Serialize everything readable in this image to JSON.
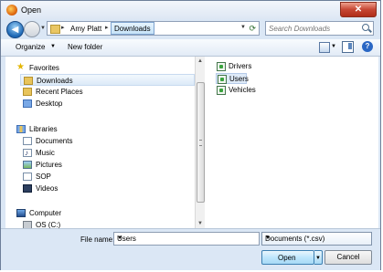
{
  "window": {
    "title": "Open",
    "close_glyph": "✕"
  },
  "address_bar": {
    "crumbs": [
      "Amy Platt",
      "Downloads"
    ],
    "separator": "▸",
    "refresh_glyph": "⟳"
  },
  "search": {
    "placeholder": "Search Downloads"
  },
  "toolbar": {
    "organize_label": "Organize",
    "new_folder_label": "New folder",
    "help_glyph": "?"
  },
  "sidebar": {
    "favorites": {
      "label": "Favorites",
      "items": [
        "Downloads",
        "Recent Places",
        "Desktop"
      ],
      "selected": "Downloads"
    },
    "libraries": {
      "label": "Libraries",
      "items": [
        "Documents",
        "Music",
        "Pictures",
        "SOP",
        "Videos"
      ]
    },
    "computer": {
      "label": "Computer",
      "items": [
        "OS (C:)"
      ]
    }
  },
  "files": {
    "items": [
      "Drivers",
      "Users",
      "Vehicles"
    ],
    "selected": "Users"
  },
  "bottom": {
    "file_name_label": "File name:",
    "file_name_value": "Users",
    "file_type_value": "Documents (*.csv)",
    "open_label": "Open",
    "cancel_label": "Cancel"
  },
  "colors": {
    "accent": "#3c7fb1",
    "selection": "#deeaf8",
    "frame": "#dbe7f5"
  }
}
